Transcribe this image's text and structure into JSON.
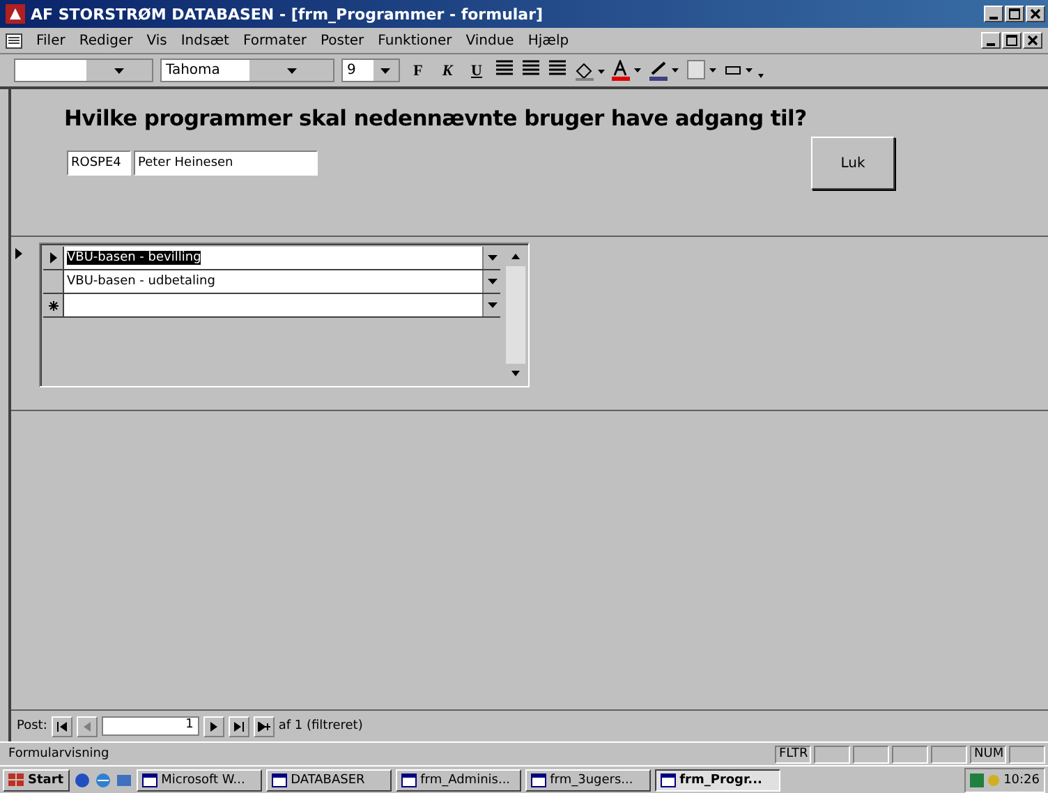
{
  "window": {
    "title": "AF STORSTRØM DATABASEN - [frm_Programmer - formular]"
  },
  "menu": [
    "Filer",
    "Rediger",
    "Vis",
    "Indsæt",
    "Formater",
    "Poster",
    "Funktioner",
    "Vindue",
    "Hjælp"
  ],
  "toolbar": {
    "font": "Tahoma",
    "size": "9",
    "styles": [
      "F",
      "K",
      "U"
    ]
  },
  "form": {
    "heading": "Hvilke programmer skal nedennævnte bruger have adgang til?",
    "user_id": "ROSPE4",
    "user_name": "Peter Heinesen",
    "close_button": "Luk"
  },
  "subform": {
    "rows": [
      {
        "kind": "record",
        "program": "VBU-basen - bevilling",
        "selected": true
      },
      {
        "kind": "record",
        "program": "VBU-basen - udbetaling",
        "selected": false
      },
      {
        "kind": "new",
        "selected": false
      }
    ]
  },
  "navigation": {
    "label": "Post:",
    "current": "1",
    "total": "af 1 (filtreret)"
  },
  "status_bar": {
    "text": "Formularvisning",
    "indicators": [
      "FLTR",
      "NUM"
    ]
  },
  "taskbar": {
    "start": "Start",
    "tasks": [
      {
        "label": "Microsoft W...",
        "selected": false
      },
      {
        "label": "DATABASER",
        "selected": false
      },
      {
        "label": "frm_Adminis...",
        "selected": false
      },
      {
        "label": "frm_3ugers...",
        "selected": false
      },
      {
        "label": "frm_Progr...",
        "selected": true
      }
    ],
    "clock": "10:26"
  }
}
